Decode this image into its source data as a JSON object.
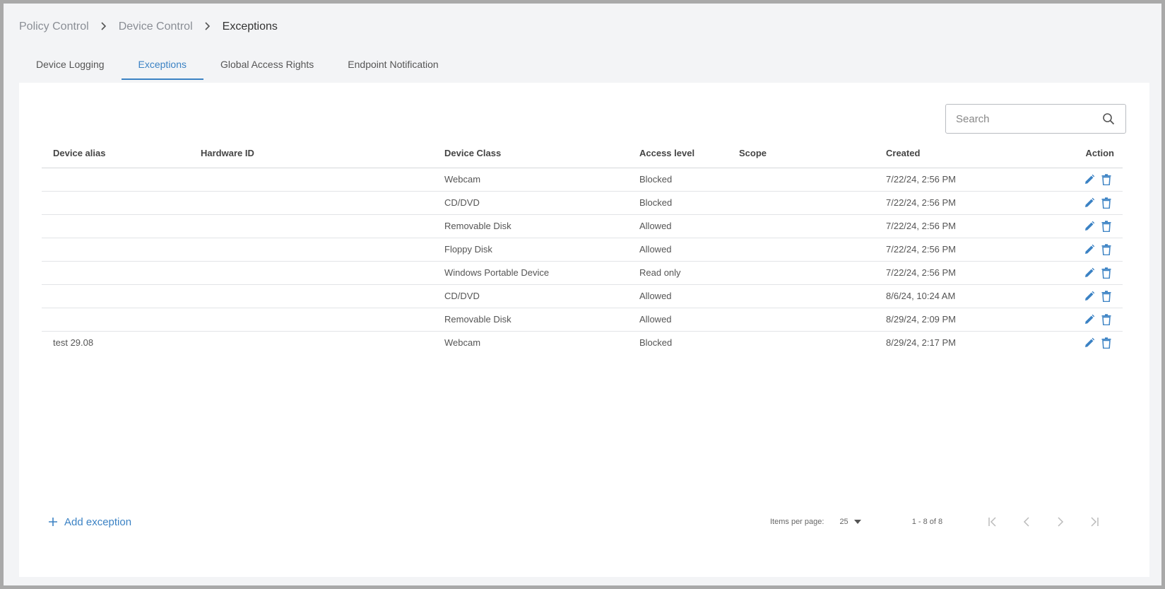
{
  "breadcrumb": [
    "Policy Control",
    "Device Control",
    "Exceptions"
  ],
  "tabs": [
    {
      "label": "Device Logging"
    },
    {
      "label": "Exceptions",
      "active": true
    },
    {
      "label": "Global Access Rights"
    },
    {
      "label": "Endpoint Notification"
    }
  ],
  "search": {
    "placeholder": "Search",
    "value": ""
  },
  "table": {
    "columns": [
      "Device alias",
      "Hardware ID",
      "Device Class",
      "Access level",
      "Scope",
      "Created",
      "Action"
    ],
    "rows": [
      {
        "alias": "",
        "hardware_id": "",
        "device_class": "Webcam",
        "access": "Blocked",
        "scope": "",
        "created": "7/22/24, 2:56 PM"
      },
      {
        "alias": "",
        "hardware_id": "",
        "device_class": "CD/DVD",
        "access": "Blocked",
        "scope": "",
        "created": "7/22/24, 2:56 PM"
      },
      {
        "alias": "",
        "hardware_id": "",
        "device_class": "Removable Disk",
        "access": "Allowed",
        "scope": "",
        "created": "7/22/24, 2:56 PM"
      },
      {
        "alias": "",
        "hardware_id": "",
        "device_class": "Floppy Disk",
        "access": "Allowed",
        "scope": "",
        "created": "7/22/24, 2:56 PM"
      },
      {
        "alias": "",
        "hardware_id": "",
        "device_class": "Windows Portable Device",
        "access": "Read only",
        "scope": "",
        "created": "7/22/24, 2:56 PM"
      },
      {
        "alias": "",
        "hardware_id": "",
        "device_class": "CD/DVD",
        "access": "Allowed",
        "scope": "",
        "created": "8/6/24, 10:24 AM"
      },
      {
        "alias": "",
        "hardware_id": "",
        "device_class": "Removable Disk",
        "access": "Allowed",
        "scope": "",
        "created": "8/29/24, 2:09 PM"
      },
      {
        "alias": "test 29.08",
        "hardware_id": "",
        "device_class": "Webcam",
        "access": "Blocked",
        "scope": "",
        "created": "8/29/24, 2:17 PM"
      }
    ]
  },
  "footer": {
    "add_label": "Add exception",
    "items_per_page_label": "Items per page:",
    "items_per_page_value": "25",
    "range": "1 - 8 of 8"
  },
  "colors": {
    "accent": "#3b82c4",
    "icon": "#3b82c4"
  }
}
